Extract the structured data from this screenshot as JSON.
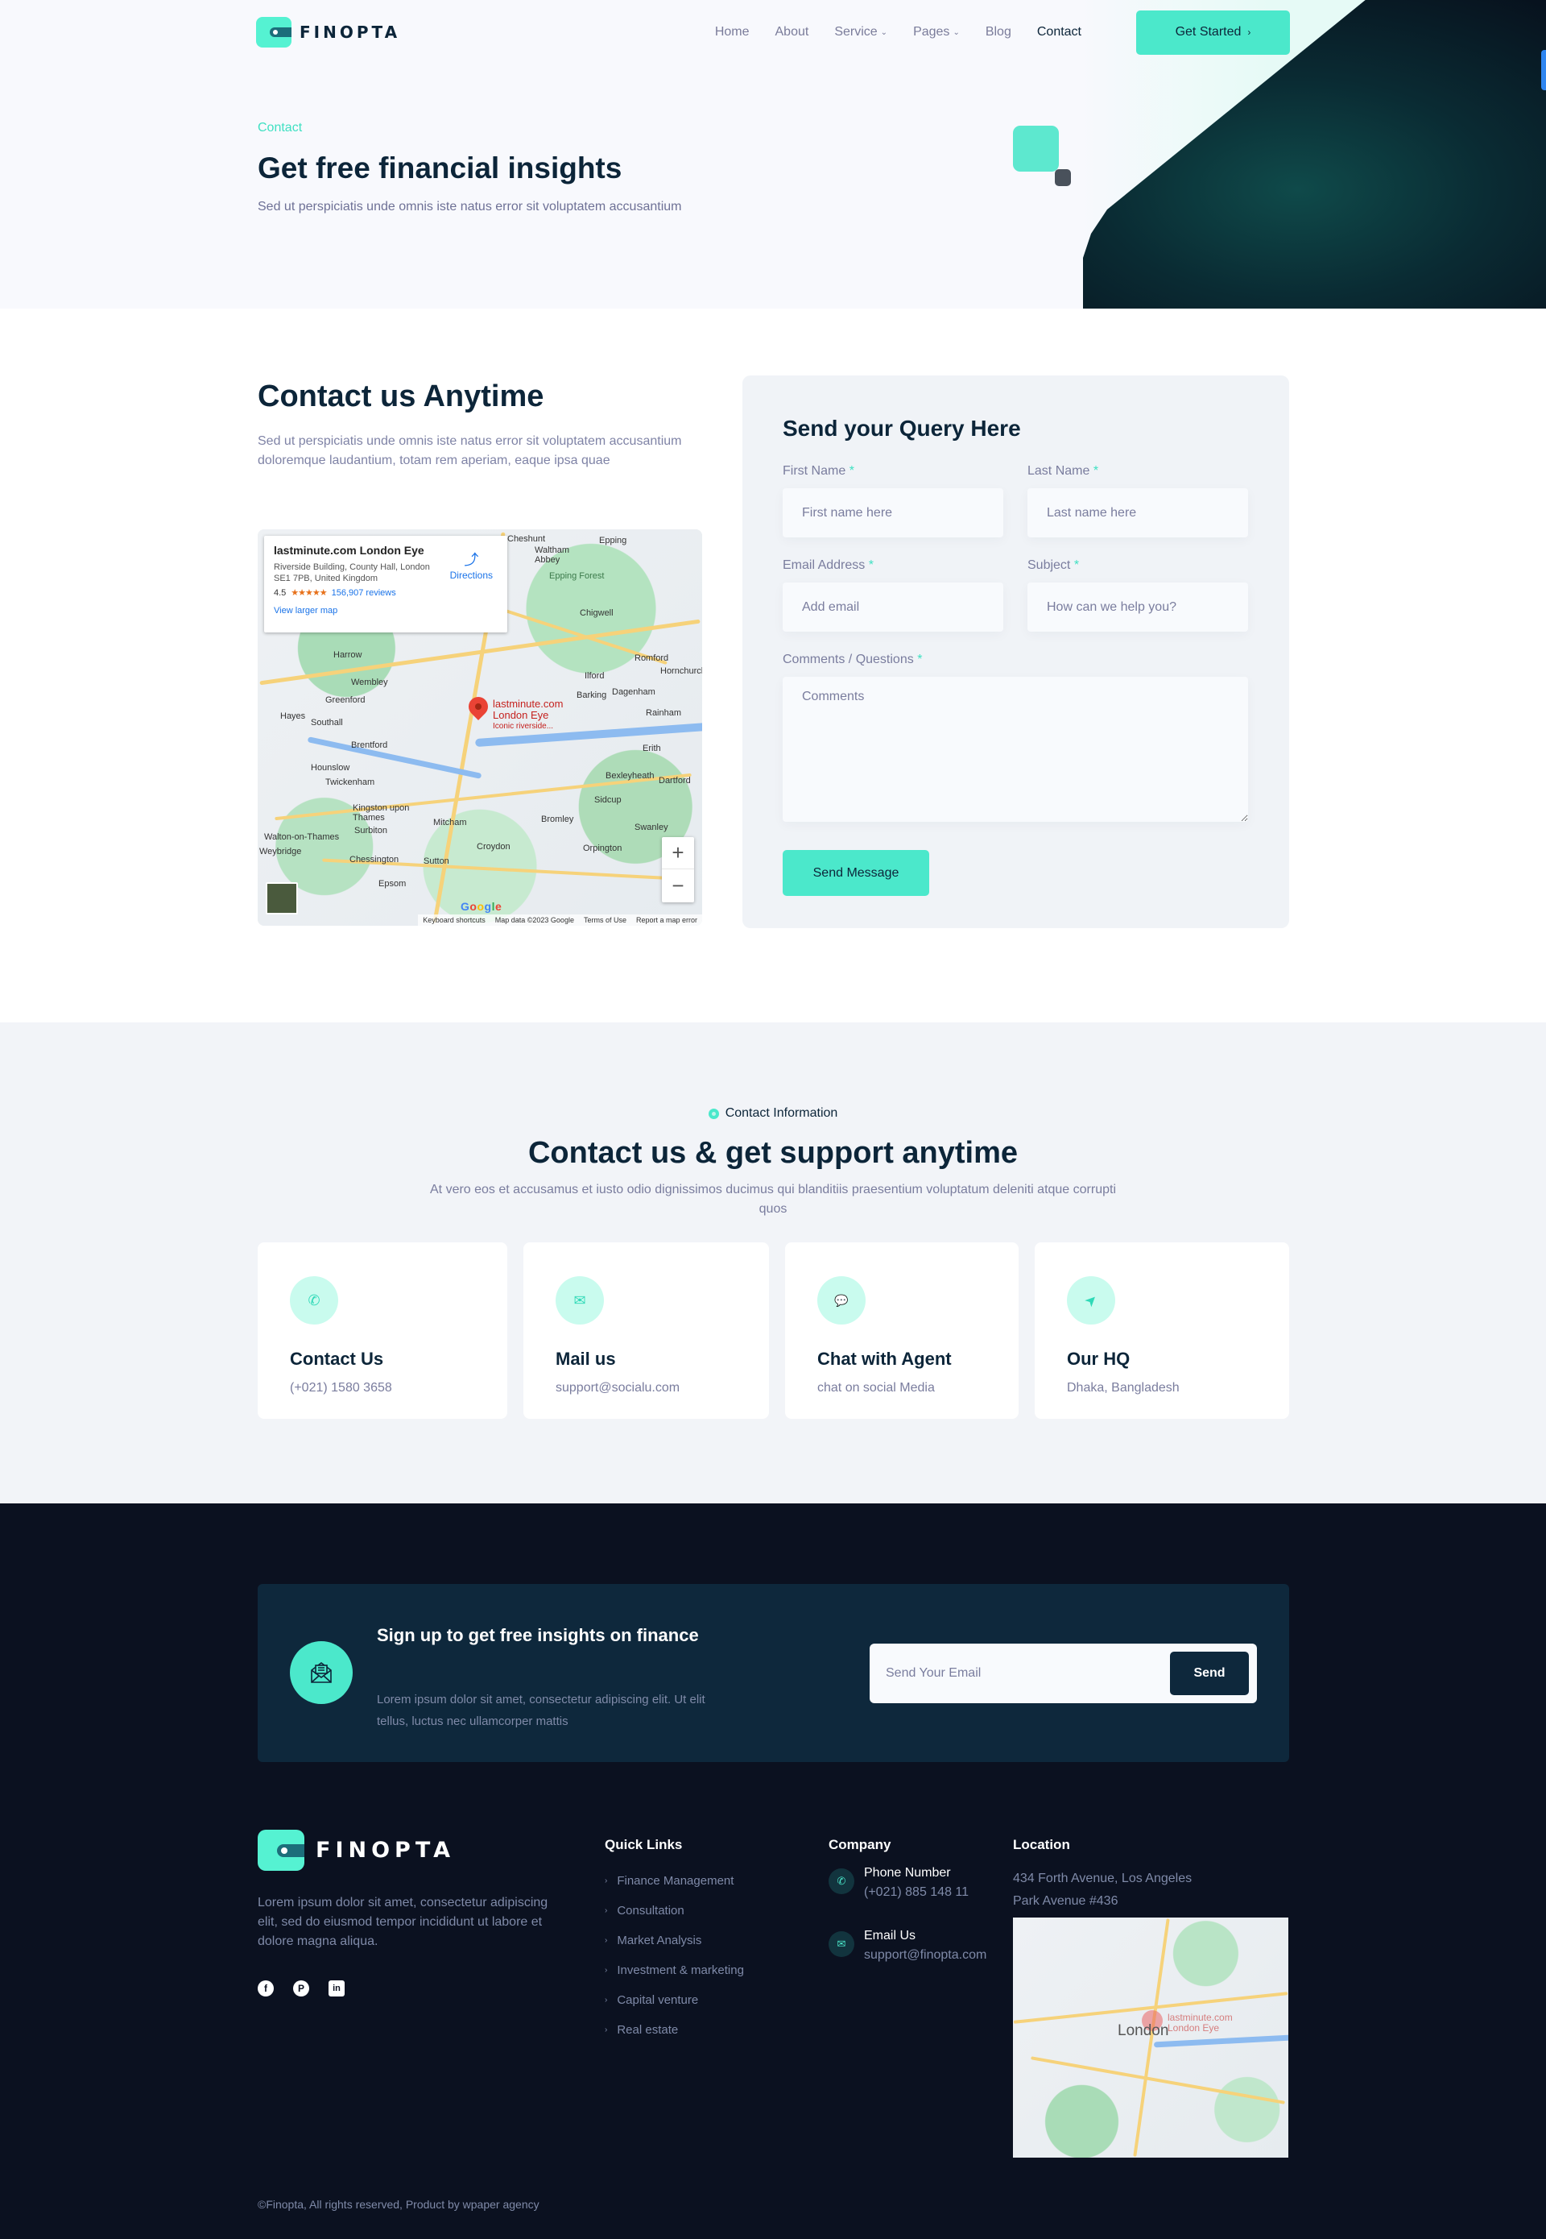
{
  "brand": {
    "name": "FINOPTA",
    "accent": "#4be8cb",
    "dark": "#0c2539"
  },
  "nav": {
    "items": [
      {
        "label": "Home",
        "has_dropdown": false,
        "active": false
      },
      {
        "label": "About",
        "has_dropdown": false,
        "active": false
      },
      {
        "label": "Service",
        "has_dropdown": true,
        "active": false
      },
      {
        "label": "Pages",
        "has_dropdown": true,
        "active": false
      },
      {
        "label": "Blog",
        "has_dropdown": false,
        "active": false
      },
      {
        "label": "Contact",
        "has_dropdown": false,
        "active": true
      }
    ],
    "cta_label": "Get Started",
    "cta_icon": "chevron-right-icon"
  },
  "hero": {
    "breadcrumb": "Contact",
    "title": "Get free financial insights",
    "subtitle": "Sed ut perspiciatis unde omnis iste natus error sit voluptatem accusantium"
  },
  "contact": {
    "title": "Contact us Anytime",
    "description": "Sed ut perspiciatis unde omnis iste natus error sit voluptatem accusantium doloremque laudantium, totam rem aperiam, eaque ipsa quae",
    "map": {
      "place_name": "lastminute.com London Eye",
      "address": "Riverside Building, County Hall, London SE1 7PB, United Kingdom",
      "rating": "4.5",
      "stars": "★★★★★",
      "reviews": "156,907 reviews",
      "view_larger": "View larger map",
      "directions": "Directions",
      "pin_title": "lastminute.com London Eye",
      "pin_subtitle": "Iconic riverside...",
      "zoom_in": "+",
      "zoom_out": "−",
      "footer_links": [
        "Keyboard shortcuts",
        "Map data ©2023 Google",
        "Terms of Use",
        "Report a map error"
      ],
      "places": [
        "Harrow",
        "Wembley",
        "Greenford",
        "Hayes",
        "Southall",
        "Brentford",
        "Hounslow",
        "Twickenham",
        "Kingston upon Thames",
        "Surbiton",
        "Walton-on-Thames",
        "Weybridge",
        "Chessington",
        "Epsom",
        "Sutton",
        "Mitcham",
        "Croydon",
        "Bromley",
        "Orpington",
        "Swanley",
        "Sidcup",
        "Bexleyheath",
        "Dartford",
        "Erith",
        "Rainham",
        "Dagenham",
        "Barking",
        "Ilford",
        "Romford",
        "Hornchurch",
        "Chigwell",
        "Epping",
        "Waltham Abbey",
        "Cheshunt",
        "Epping Forest"
      ]
    },
    "form": {
      "title": "Send your Query Here",
      "fields": {
        "first_name": {
          "label": "First Name",
          "placeholder": "First name here",
          "value": ""
        },
        "last_name": {
          "label": "Last Name",
          "placeholder": "Last name here",
          "value": ""
        },
        "email": {
          "label": "Email Address",
          "placeholder": "Add email",
          "value": ""
        },
        "subject": {
          "label": "Subject",
          "placeholder": "How can we help you?",
          "value": ""
        },
        "comments": {
          "label": "Comments / Questions",
          "placeholder": "Comments",
          "value": ""
        }
      },
      "required_mark": "*",
      "submit_label": "Send Message"
    }
  },
  "info": {
    "badge": "Contact Information",
    "title": "Contact us & get support anytime",
    "description": "At vero eos et accusamus et iusto odio dignissimos ducimus qui blanditiis praesentium voluptatum deleniti atque corrupti quos",
    "cards": [
      {
        "icon": "phone-icon",
        "glyph": "✆",
        "title": "Contact Us",
        "value": "(+021) 1580 3658"
      },
      {
        "icon": "mail-icon",
        "glyph": "✉",
        "title": "Mail us",
        "value": "support@socialu.com"
      },
      {
        "icon": "messenger-icon",
        "glyph": "💬",
        "title": "Chat with Agent",
        "value": "chat on social Media"
      },
      {
        "icon": "location-arrow-icon",
        "glyph": "➤",
        "title": "Our HQ",
        "value": "Dhaka, Bangladesh"
      }
    ]
  },
  "signup": {
    "title": "Sign up to get free insights on finance",
    "description": "Lorem ipsum dolor sit amet, consectetur adipiscing elit. Ut elit tellus, luctus nec ullamcorper mattis",
    "email_placeholder": "Send Your Email",
    "email_value": "",
    "button_label": "Send"
  },
  "footer": {
    "about": "Lorem ipsum dolor sit amet, consectetur adipiscing elit, sed do eiusmod tempor incididunt ut labore et dolore magna aliqua.",
    "socials": [
      {
        "name": "facebook-icon",
        "glyph": "f"
      },
      {
        "name": "pinterest-icon",
        "glyph": "P"
      },
      {
        "name": "linkedin-icon",
        "glyph": "in"
      }
    ],
    "quick_links": {
      "title": "Quick Links",
      "items": [
        "Finance Management",
        "Consultation",
        "Market Analysis",
        "Investment & marketing",
        "Capital venture",
        "Real estate"
      ]
    },
    "company": {
      "title": "Company",
      "items": [
        {
          "icon": "phone-icon",
          "glyph": "✆",
          "label": "Phone Number",
          "value": "(+021) 885 148 11"
        },
        {
          "icon": "mail-icon",
          "glyph": "✉",
          "label": "Email Us",
          "value": "support@finopta.com"
        }
      ]
    },
    "location": {
      "title": "Location",
      "address_line1": "434 Forth Avenue, Los Angeles",
      "address_line2": "Park Avenue #436",
      "map_city": "London",
      "map_pin_label": "lastminute.com London Eye"
    },
    "copyright": "©Finopta, All rights reserved, Product by wpaper agency"
  }
}
